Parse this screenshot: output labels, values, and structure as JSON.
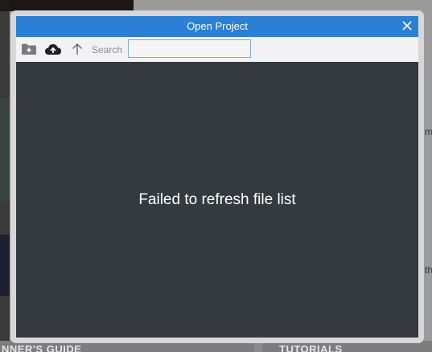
{
  "background": {
    "bottom_labels": [
      "NNER'S GUIDE",
      "TUTORIALS"
    ],
    "right_fragments": [
      "m",
      "th"
    ]
  },
  "dialog": {
    "title": "Open Project",
    "toolbar": {
      "new_folder_icon": "new-folder-icon",
      "upload_icon": "cloud-upload-icon",
      "up_icon": "arrow-up-icon",
      "search_label": "Search",
      "search_value": ""
    },
    "message": "Failed to refresh file list"
  },
  "colors": {
    "titlebar": "#2b7fd4",
    "content": "#343a3f",
    "toolbar": "#f2f2f2"
  }
}
